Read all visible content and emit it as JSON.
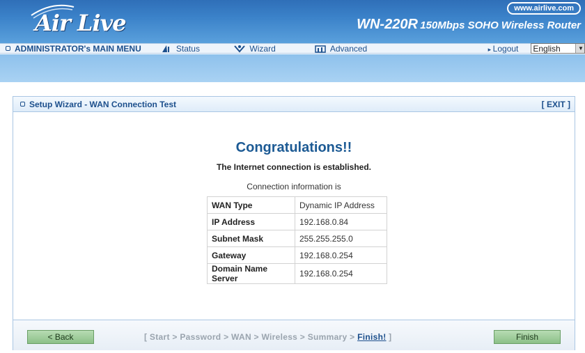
{
  "header": {
    "logo": "Air Live",
    "website": "www.airlive.com",
    "model": "WN-220R",
    "model_desc": "150Mbps SOHO Wireless Router"
  },
  "menu": {
    "admin": "ADMINISTRATOR's MAIN MENU",
    "status": "Status",
    "wizard": "Wizard",
    "advanced": "Advanced",
    "logout": "Logout",
    "language": "English"
  },
  "panel": {
    "title": "Setup Wizard - WAN Connection Test",
    "exit": "[ EXIT ]",
    "heading": "Congratulations!!",
    "message": "The Internet connection is established.",
    "info_caption": "Connection information is",
    "rows": [
      {
        "key": "WAN Type",
        "value": "Dynamic IP Address"
      },
      {
        "key": "IP Address",
        "value": "192.168.0.84"
      },
      {
        "key": "Subnet Mask",
        "value": "255.255.255.0"
      },
      {
        "key": "Gateway",
        "value": "192.168.0.254"
      },
      {
        "key": "Domain Name Server",
        "value": "192.168.0.254"
      }
    ]
  },
  "footer": {
    "back": "< Back",
    "finish": "Finish",
    "steps_prefix": "[ Start > Password > WAN > Wireless > Summary > ",
    "steps_current": "Finish!",
    "steps_suffix": " ]"
  }
}
